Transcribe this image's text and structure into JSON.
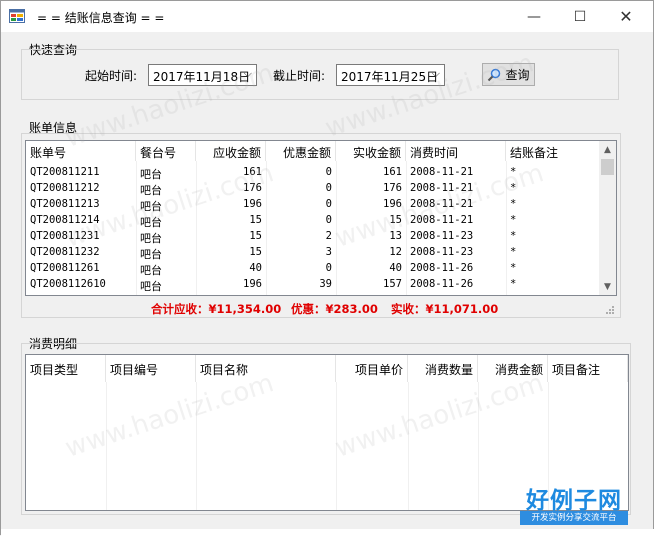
{
  "window": {
    "title": "= = 结账信息查询 = =",
    "min_glyph": "—",
    "max_glyph": "☐",
    "close_glyph": "✕"
  },
  "quick_search": {
    "legend": "快速查询",
    "start_label": "起始时间:",
    "start_value": "2017年11月18日",
    "end_label": "截止时间:",
    "end_value": "2017年11月25日",
    "query_button": "查询",
    "chevron": "⌵"
  },
  "bills": {
    "legend": "账单信息",
    "columns": [
      "账单号",
      "餐台号",
      "应收金额",
      "优惠金额",
      "实收金额",
      "消费时间",
      "结账备注"
    ],
    "rows": [
      [
        "QT200811211",
        "吧台",
        "161",
        "0",
        "161",
        "2008-11-21",
        "*"
      ],
      [
        "QT200811212",
        "吧台",
        "176",
        "0",
        "176",
        "2008-11-21",
        "*"
      ],
      [
        "QT200811213",
        "吧台",
        "196",
        "0",
        "196",
        "2008-11-21",
        "*"
      ],
      [
        "QT200811214",
        "吧台",
        "15",
        "0",
        "15",
        "2008-11-21",
        "*"
      ],
      [
        "QT200811231",
        "吧台",
        "15",
        "2",
        "13",
        "2008-11-23",
        "*"
      ],
      [
        "QT200811232",
        "吧台",
        "15",
        "3",
        "12",
        "2008-11-23",
        "*"
      ],
      [
        "QT200811261",
        "吧台",
        "40",
        "0",
        "40",
        "2008-11-26",
        "*"
      ],
      [
        "QT2008112610",
        "吧台",
        "196",
        "39",
        "157",
        "2008-11-26",
        "*"
      ]
    ],
    "scroll_up": "▲",
    "scroll_down": "▼",
    "total_due": "合计应收：¥11,354.00",
    "discount": "优惠：¥283.00",
    "received": "实收：¥11,071.00"
  },
  "details": {
    "legend": "消费明细",
    "columns": [
      "项目类型",
      "项目编号",
      "项目名称",
      "项目单价",
      "消费数量",
      "消费金额",
      "项目备注"
    ]
  },
  "watermark": {
    "text": "www.haolizi.com",
    "brand": "好例子网",
    "brand_sub": "开发实例分享交流平台"
  },
  "colors": {
    "totals": "#e00000",
    "brand": "#1e8ae0"
  }
}
